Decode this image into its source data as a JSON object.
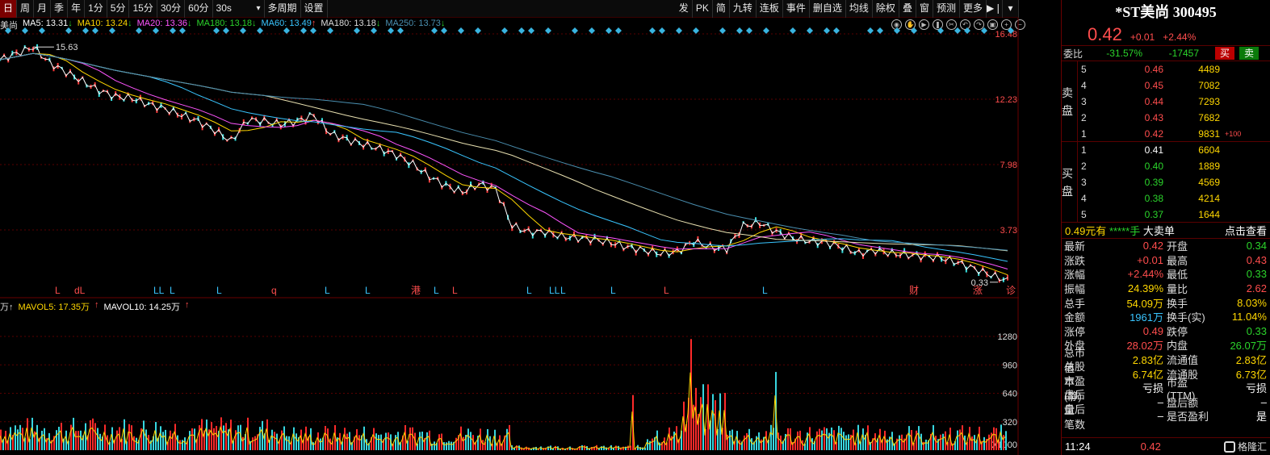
{
  "toolbar": {
    "left": [
      "日",
      "周",
      "月",
      "季",
      "年",
      "1分",
      "5分",
      "15分",
      "30分",
      "60分"
    ],
    "interval": "30s",
    "extra": [
      "多周期",
      "设置"
    ],
    "right": [
      "发",
      "PK",
      "简",
      "九转",
      "连板",
      "事件",
      "删自选",
      "均线",
      "除权",
      "叠",
      "窗",
      "预测",
      "更多"
    ],
    "selected": "日"
  },
  "ma": {
    "prefix": "美尚",
    "items": [
      {
        "label": "MA5: 13.31",
        "arrow": "↓",
        "color": "#ffffff"
      },
      {
        "label": "MA10: 13.24",
        "arrow": "↓",
        "color": "#ffd700"
      },
      {
        "label": "MA20: 13.36",
        "arrow": "↓",
        "color": "#ff55ff"
      },
      {
        "label": "MA180: 13.18",
        "arrow": "↓",
        "color": "#2bd42b"
      },
      {
        "label": "MA60: 13.49",
        "arrow": "↑",
        "color": "#39c5ff"
      },
      {
        "label": "MA180: 13.18",
        "arrow": "↓",
        "color": "#dddddd"
      },
      {
        "label": "MA250: 13.73",
        "arrow": "↓",
        "color": "#4a8fb0"
      }
    ]
  },
  "price_axis": [
    "16.48",
    "12.23",
    "7.98",
    "3.73"
  ],
  "annotations": {
    "high": "15.63",
    "low": "0.33"
  },
  "event_marks": [
    {
      "t": "L",
      "c": "red"
    },
    {
      "t": "dL",
      "c": "red"
    },
    {
      "t": "LL",
      "c": "cyan"
    },
    {
      "t": "L",
      "c": "cyan"
    },
    {
      "t": "L",
      "c": "cyan"
    },
    {
      "t": "q",
      "c": "red"
    },
    {
      "t": "L",
      "c": "cyan"
    },
    {
      "t": "L",
      "c": "cyan"
    },
    {
      "t": "港",
      "c": "red"
    },
    {
      "t": "L",
      "c": "cyan"
    },
    {
      "t": "L",
      "c": "red"
    },
    {
      "t": "L",
      "c": "cyan"
    },
    {
      "t": "LL",
      "c": "cyan"
    },
    {
      "t": "L",
      "c": "cyan"
    },
    {
      "t": "L",
      "c": "cyan"
    },
    {
      "t": "L",
      "c": "red"
    },
    {
      "t": "L",
      "c": "cyan"
    },
    {
      "t": "财",
      "c": "red"
    },
    {
      "t": "涨",
      "c": "red"
    },
    {
      "t": "诊",
      "c": "red"
    }
  ],
  "volume": {
    "prefix": "万↑",
    "mavol5": "MAVOL5: 17.35万",
    "mavol10": "MAVOL10: 14.25万",
    "axis": [
      "1280",
      "960",
      "640",
      "320"
    ],
    "unit": "X1000"
  },
  "panel": {
    "title": "*ST美尚 300495",
    "price": "0.42",
    "change": "+0.01",
    "change_pct": "+2.44%",
    "weibi_label": "委比",
    "weibi": "-31.57%",
    "weicha": "-17457",
    "buy_btn": "买",
    "sell_btn": "卖",
    "sell_side": "卖盘",
    "buy_side": "买盘",
    "asks": [
      {
        "n": "5",
        "p": "0.46",
        "v": "4489",
        "x": ""
      },
      {
        "n": "4",
        "p": "0.45",
        "v": "7082",
        "x": ""
      },
      {
        "n": "3",
        "p": "0.44",
        "v": "7293",
        "x": ""
      },
      {
        "n": "2",
        "p": "0.43",
        "v": "7682",
        "x": ""
      },
      {
        "n": "1",
        "p": "0.42",
        "v": "9831",
        "x": "+100"
      }
    ],
    "bids": [
      {
        "n": "1",
        "p": "0.41",
        "v": "6604"
      },
      {
        "n": "2",
        "p": "0.40",
        "v": "1889"
      },
      {
        "n": "3",
        "p": "0.39",
        "v": "4569"
      },
      {
        "n": "4",
        "p": "0.38",
        "v": "4214"
      },
      {
        "n": "5",
        "p": "0.37",
        "v": "1644"
      }
    ],
    "bigorder": {
      "a": "0.49元有",
      "b": "*****手",
      "c": "大卖单",
      "d": "点击查看"
    },
    "stats": [
      {
        "k": "最新",
        "v": "0.42",
        "vc": "red",
        "k2": "开盘",
        "v2": "0.34",
        "v2c": "green"
      },
      {
        "k": "涨跌",
        "v": "+0.01",
        "vc": "red",
        "k2": "最高",
        "v2": "0.43",
        "v2c": "red"
      },
      {
        "k": "涨幅",
        "v": "+2.44%",
        "vc": "red",
        "k2": "最低",
        "v2": "0.33",
        "v2c": "green"
      },
      {
        "k": "振幅",
        "v": "24.39%",
        "vc": "yellow",
        "k2": "量比",
        "v2": "2.62",
        "v2c": "red"
      },
      {
        "k": "总手",
        "v": "54.09万",
        "vc": "yellow",
        "k2": "换手",
        "v2": "8.03%",
        "v2c": "yellow"
      },
      {
        "k": "金额",
        "v": "1961万",
        "vc": "cyan",
        "k2": "换手(实)",
        "v2": "11.04%",
        "v2c": "yellow"
      },
      {
        "k": "涨停",
        "v": "0.49",
        "vc": "red",
        "k2": "跌停",
        "v2": "0.33",
        "v2c": "green"
      },
      {
        "k": "外盘",
        "v": "28.02万",
        "vc": "red",
        "k2": "内盘",
        "v2": "26.07万",
        "v2c": "green"
      },
      {
        "k": "总市值",
        "v": "2.83亿",
        "vc": "yellow",
        "k2": "流通值",
        "v2": "2.83亿",
        "v2c": "yellow"
      },
      {
        "k": "总股本",
        "v": "6.74亿",
        "vc": "yellow",
        "k2": "流通股",
        "v2": "6.73亿",
        "v2c": "yellow"
      },
      {
        "k": "市盈(静)",
        "v": "亏损",
        "vc": "white",
        "k2": "市盈(TTM)",
        "v2": "亏损",
        "v2c": "white"
      },
      {
        "k": "盘后量",
        "v": "–",
        "vc": "white",
        "k2": "盘后额",
        "v2": "–",
        "v2c": "white"
      },
      {
        "k": "盘后笔数",
        "v": "–",
        "vc": "white",
        "k2": "是否盈利",
        "v2": "是",
        "v2c": "white"
      }
    ],
    "time": "11:24",
    "time_price": "0.42",
    "brand": "格隆汇"
  },
  "chart_data": {
    "type": "line",
    "title": "",
    "price_range": [
      0.33,
      16.48
    ],
    "close_path": [
      14.8,
      15.2,
      15.63,
      14.6,
      14.0,
      13.4,
      12.8,
      12.4,
      12.3,
      11.9,
      11.6,
      11.2,
      10.8,
      10.2,
      9.5,
      10.9,
      10.8,
      10.6,
      10.8,
      11.2,
      10.0,
      9.6,
      9.3,
      9.0,
      8.6,
      8.0,
      7.2,
      6.6,
      6.2,
      6.7,
      6.4,
      4.0,
      3.6,
      3.6,
      3.3,
      3.2,
      3.1,
      2.9,
      2.6,
      2.4,
      2.2,
      2.3,
      3.0,
      2.6,
      2.5,
      4.0,
      4.2,
      3.6,
      3.2,
      3.0,
      2.9,
      2.6,
      2.2,
      2.4,
      2.2,
      2.1,
      2.0,
      1.9,
      1.6,
      1.2,
      0.8,
      0.42
    ],
    "volume_range": [
      0,
      1280
    ],
    "volume_axis_ticks": [
      320,
      640,
      960,
      1280
    ],
    "volume_note": "volume peaks near 1280 (X1000) mid-chart"
  }
}
